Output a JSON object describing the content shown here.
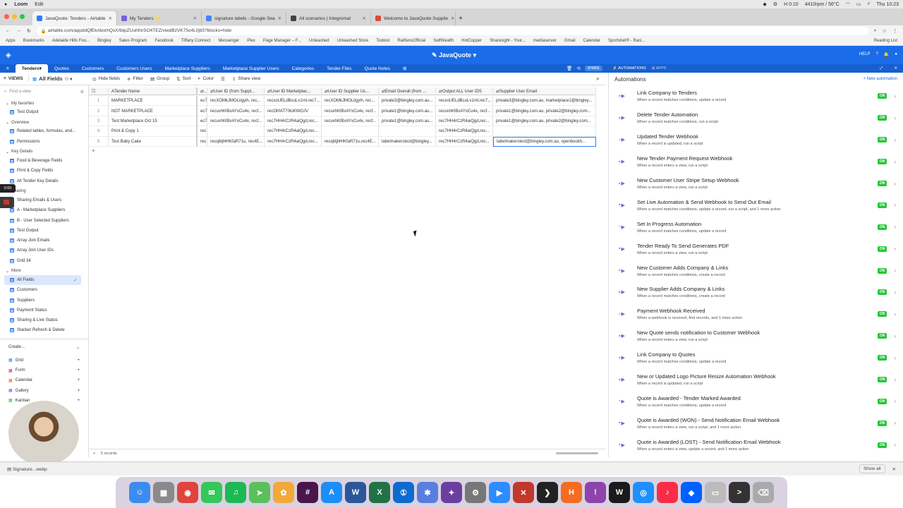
{
  "menubar": {
    "app": "Loom",
    "menu": "Edit",
    "cpu": "4410rpm / 56°C",
    "timer": "0:10",
    "clock": "Thu 10:23"
  },
  "browser_tabs": [
    {
      "label": "JavaQuote: Tenders - Airtable",
      "color": "#2d7ff9",
      "active": true
    },
    {
      "label": "My Tenders ⭐",
      "color": "#7b5fe0",
      "active": false
    },
    {
      "label": "signature labels - Google Sea",
      "color": "#4285f4",
      "active": false
    },
    {
      "label": "All scenarios | Integromat",
      "color": "#444444",
      "active": false
    },
    {
      "label": "Welcome to JavaQuote Supplie",
      "color": "#e2453c",
      "active": false
    }
  ],
  "address": "airtable.com/appddQfEkAborhQsX/tbipZUuhfnrSO4TEZ/viwdBzVK75o4L0jb5?blocks=hide",
  "bookmarks": [
    "Apps",
    "Bookmarks",
    "Adelaide Hills Foo...",
    "Bingley",
    "Sales Program",
    "Facebook",
    "Tiffany Connect",
    "Messenger",
    "Plex",
    "Page Manager – F...",
    "Unleashed",
    "Unleashed Store",
    "Todoist",
    "RailfansOfficial",
    "SelfWealth",
    "HotCopper",
    "Sharesight - Your...",
    "mediaserver",
    "Gmail",
    "Calendar",
    "Sportsbet® - Raci..."
  ],
  "reading_list": "Reading List",
  "base": {
    "name": "JavaQuote",
    "help": "HELP"
  },
  "table_tabs": [
    "Tenders",
    "Quotes",
    "Customers",
    "Customers Users",
    "Marketplace Suppliers",
    "Marketplace Supplier Users",
    "Categories",
    "Tender Files",
    "Quote Notes"
  ],
  "share": "SHARE",
  "automations_tab": "AUTOMATIONS",
  "apps_tab": "APPS",
  "toolbar": {
    "views": "VIEWS",
    "view_name": "All Fields",
    "hide": "Hide fields",
    "filter": "Filter",
    "group": "Group",
    "sort": "Sort",
    "color": "Color",
    "share_view": "Share view"
  },
  "sidebar": {
    "find": "Find a view",
    "sections": [
      {
        "title": "My favorites",
        "items": [
          "Test Output"
        ]
      },
      {
        "title": "Overview",
        "items": [
          "Related tables, formulas, and...",
          "Permissions"
        ]
      },
      {
        "title": "Key Details",
        "items": [
          "Food & Beverage Fields",
          "Print & Copy Fields",
          "All Tender Key Details"
        ]
      },
      {
        "title": "Sharing",
        "items": [
          "Sharing Emails & Users",
          "A - Marketplace Suppliers",
          "B - User Selected Suppliers",
          "Test Output",
          "Array Join Emails",
          "Array Join User IDs",
          "Grid 34"
        ]
      },
      {
        "title": "More",
        "items": [
          "All Fields",
          "Customers",
          "Suppliers",
          "Payment Status",
          "Sharing & Live Status",
          "Stacker Refresh & Delete"
        ]
      }
    ],
    "selected": "All Fields",
    "create": "Create...",
    "create_items": [
      "Grid",
      "Form",
      "Calendar",
      "Gallery",
      "Kanban"
    ]
  },
  "grid": {
    "columns": [
      "Tender Name",
      "...",
      "User ID (from Suppl...",
      "User ID Marketplac...",
      "User ID Supplier Us...",
      "Email Overall (from ...",
      "Output ALL User IDS",
      "Supplier User Email"
    ],
    "rows": [
      [
        "1",
        "MARKETPLACE",
        "ec7...",
        "recXOMkJMOLilgyih, rec...",
        "recsoUELdBcuLv1ml,rec7...",
        "recXOMkJMOLilgyih, rec...",
        "private3@bingley.com.au...",
        "recsoUELdBcuLv1ml,rec7...",
        "private3@bingley.com.au, marketplace1@bingley..."
      ],
      [
        "2",
        "NOT MARKETPLACE",
        "ec7...",
        "recuxhKlBxAYxCu4x, recf...",
        "recOhfAT70ioKWOJV",
        "recuxhKlBxAYxCu4x, recf...",
        "private1@bingley.com.au...",
        "recuxhKlBxAYxCu4x, recf...",
        "private1@bingley.com.au, private2@bingley.com..."
      ],
      [
        "3",
        "Test Marketplace Oct 15",
        "ec7...",
        "recuxhKlBxAYxCu4x, recf...",
        "rec7HH4rCzR4aiQgd,rec...",
        "recuxhKlBxAYxCu4x, recf...",
        "private1@bingley.com.au...",
        "rec7HH4rCzR4aiQgd,rec...",
        "private1@bingley.com.au, private2@bingley.com..."
      ],
      [
        "4",
        "Print & Copy 1",
        "rec...",
        "",
        "rec7HH4rCzR4aiQgd,rec...",
        "",
        "",
        "rec7HH4rCzR4aiQgd,rec...",
        ""
      ],
      [
        "5",
        "Test Baby Cake",
        "rec...",
        "recqbtjl4HKfaR71u, rec4E...",
        "rec7HH4rCzR4aiQgd,rec...",
        "recqbtjl4HKfaR71u,rec4E...",
        "labelmakerstest@bingley...",
        "rec7HH4rCzR4aiQgd,rec...",
        "labelmakerstest@bingley.com.au, openbookh..."
      ]
    ],
    "record_count": "5 records",
    "add_row": "+"
  },
  "automations": {
    "title": "Automations",
    "new_label": "New automation",
    "items": [
      {
        "name": "Link Company to Tenders",
        "desc": "When a record matches conditions, update a record",
        "status": "ON"
      },
      {
        "name": "Delete Tender Automation",
        "desc": "When a record matches conditions, run a script",
        "status": "ON"
      },
      {
        "name": "Updated Tender Webhook",
        "desc": "When a record is updated, run a script",
        "status": "ON"
      },
      {
        "name": "New Tender Payment Request Webhook",
        "desc": "When a record enters a view, run a script",
        "status": "ON"
      },
      {
        "name": "New Customer User Stripe Setup Webhook",
        "desc": "When a record enters a view, run a script",
        "status": "ON"
      },
      {
        "name": "Set Live Automation & Send Webhook to Send Out Email",
        "desc": "When a record matches conditions, update a record, run a script, and 1 more action",
        "status": "ON"
      },
      {
        "name": "Set In Progress Automation",
        "desc": "When a record matches conditions, update a record",
        "status": "ON"
      },
      {
        "name": "Tender Ready To Send Generates PDF",
        "desc": "When a record enters a view, run a script",
        "status": "ON"
      },
      {
        "name": "New Customer Adds Company & Links",
        "desc": "When a record matches conditions, create a record",
        "status": "ON"
      },
      {
        "name": "New Supplier Adds Company & Links",
        "desc": "When a record matches conditions, create a record",
        "status": "ON"
      },
      {
        "name": "Payment Webhook Received",
        "desc": "When a webhook is received, find records, and 1 more action",
        "status": "ON"
      },
      {
        "name": "New Quote sends notification to Customer Webhook",
        "desc": "When a record enters a view, run a script",
        "status": "ON"
      },
      {
        "name": "Link Company to Quotes",
        "desc": "When a record matches conditions, update a record",
        "status": "ON"
      },
      {
        "name": "New or Updated Logo Picture Resize Automation Webhook",
        "desc": "When a record is updated, run a script",
        "status": "ON"
      },
      {
        "name": "Quote is Awarded - Tender Marked Awarded",
        "desc": "When a record matches conditions, update a record",
        "status": "ON"
      },
      {
        "name": "Quote is Awarded (WON) - Send Notification Email Webhook",
        "desc": "When a record enters a view, run a script, and 1 more action",
        "status": "ON"
      },
      {
        "name": "Quote is Awarded (LOST) - Send Notification Email Webhook",
        "desc": "When a record enters a view, update a record, and 1 more action",
        "status": "ON"
      }
    ]
  },
  "download": {
    "file": "Signature...webp",
    "show_all": "Show all"
  },
  "rec_chip": "0:00",
  "dock": [
    {
      "icon": "finder-icon",
      "color": "#3c8cf0",
      "glyph": "☺"
    },
    {
      "icon": "launchpad-icon",
      "color": "#8a8a8a",
      "glyph": "▦"
    },
    {
      "icon": "chrome-icon",
      "color": "#e0443a",
      "glyph": "◉"
    },
    {
      "icon": "messages-icon",
      "color": "#34c759",
      "glyph": "✉"
    },
    {
      "icon": "spotify-icon",
      "color": "#1db954",
      "glyph": "♫"
    },
    {
      "icon": "maps-icon",
      "color": "#5ac15a",
      "glyph": "➤"
    },
    {
      "icon": "photos-icon",
      "color": "#f2a93b",
      "glyph": "✿"
    },
    {
      "icon": "slack-icon",
      "color": "#4a154b",
      "glyph": "#"
    },
    {
      "icon": "appstore-icon",
      "color": "#1c8ef9",
      "glyph": "A"
    },
    {
      "icon": "word-icon",
      "color": "#2b579a",
      "glyph": "W"
    },
    {
      "icon": "excel-icon",
      "color": "#217346",
      "glyph": "X"
    },
    {
      "icon": "1password-icon",
      "color": "#0e6ad0",
      "glyph": "①"
    },
    {
      "icon": "settings-gear-icon",
      "color": "#5a7de0",
      "glyph": "✱"
    },
    {
      "icon": "affinity-icon",
      "color": "#6b3fa0",
      "glyph": "✦"
    },
    {
      "icon": "system-prefs-icon",
      "color": "#777777",
      "glyph": "⚙"
    },
    {
      "icon": "zoom-icon",
      "color": "#2d8cff",
      "glyph": "▶"
    },
    {
      "icon": "scrivener-icon",
      "color": "#c0392b",
      "glyph": "✕"
    },
    {
      "icon": "plex-icon",
      "color": "#222222",
      "glyph": "❯"
    },
    {
      "icon": "harvest-icon",
      "color": "#f36c21",
      "glyph": "H"
    },
    {
      "icon": "feedback-icon",
      "color": "#8e44ad",
      "glyph": "!"
    },
    {
      "icon": "webflow-icon",
      "color": "#1a1a1a",
      "glyph": "W"
    },
    {
      "icon": "safari-icon",
      "color": "#1e90ff",
      "glyph": "◎"
    },
    {
      "icon": "music-icon",
      "color": "#fa2d48",
      "glyph": "♪"
    },
    {
      "icon": "dropbox-icon",
      "color": "#0061fe",
      "glyph": "◆"
    },
    {
      "icon": "printer-icon",
      "color": "#bbbbbb",
      "glyph": "▭"
    },
    {
      "icon": "terminal-icon",
      "color": "#333333",
      "glyph": ">"
    },
    {
      "icon": "trash-icon",
      "color": "#aaaaaa",
      "glyph": "⌫"
    }
  ]
}
